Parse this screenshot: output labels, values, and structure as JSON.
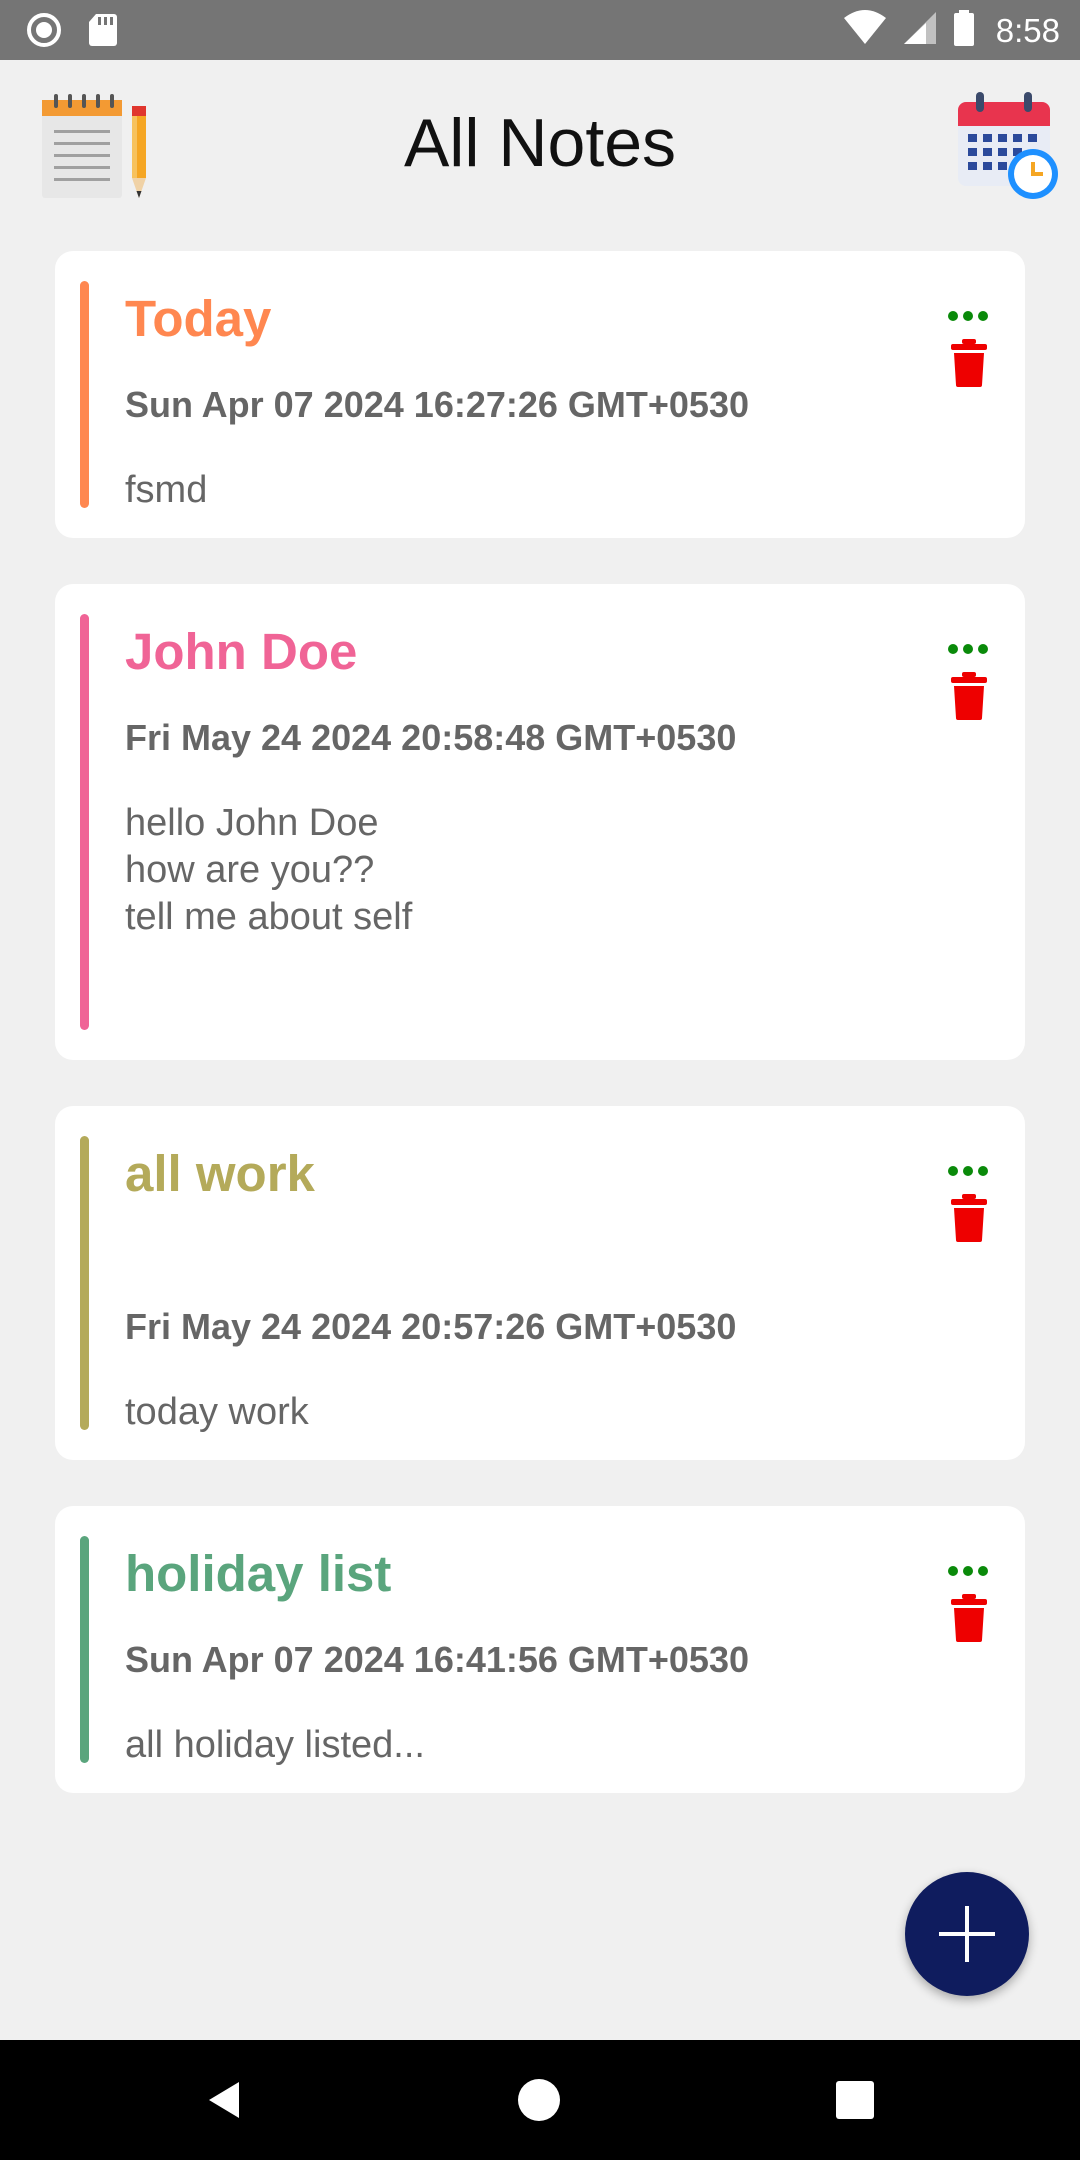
{
  "status_bar": {
    "time": "8:58",
    "left_icons": [
      "circle-record-icon",
      "sd-card-icon"
    ],
    "right_icons": [
      "wifi-icon",
      "cell-signal-icon",
      "battery-icon"
    ]
  },
  "header": {
    "title": "All Notes",
    "left_icon": "notepad-pencil-icon",
    "right_icon": "calendar-clock-icon"
  },
  "notes": [
    {
      "title": "Today",
      "date": "Sun Apr 07 2024 16:27:26 GMT+0530",
      "body": "fsmd",
      "color": "#ff8750"
    },
    {
      "title": "John Doe",
      "date": "Fri May 24 2024 20:58:48 GMT+0530",
      "body": "hello John Doe\nhow are you??\ntell me about self",
      "color": "#f06496"
    },
    {
      "title": "all work",
      "date": "Fri May 24 2024 20:57:26 GMT+0530",
      "body": "today work",
      "color": "#b4aa5a"
    },
    {
      "title": "holiday list",
      "date": "Sun Apr 07 2024 16:41:56 GMT+0530",
      "body": "all holiday listed...",
      "color": "#5aa57d"
    }
  ],
  "note_actions": {
    "more_icon": "more-dots-icon",
    "more_color": "#0a8a0a",
    "delete_icon": "trash-icon",
    "delete_color": "#ee0000"
  },
  "fab": {
    "icon": "plus-icon",
    "color": "#0f1c5e"
  },
  "nav_bar": {
    "buttons": [
      "back-icon",
      "home-icon",
      "recents-icon"
    ]
  }
}
